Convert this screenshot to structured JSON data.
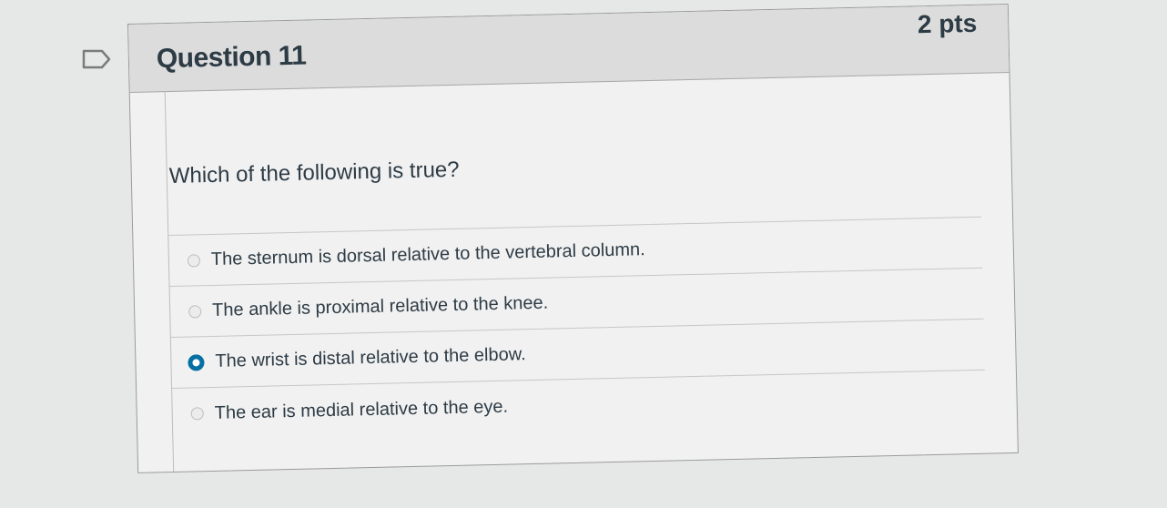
{
  "question": {
    "title": "Question 11",
    "points": "2 pts",
    "text": "Which of the following is true?",
    "answers": [
      {
        "label": "The sternum is dorsal relative to the vertebral column.",
        "selected": false
      },
      {
        "label": "The ankle is proximal relative to the knee.",
        "selected": false
      },
      {
        "label": "The wrist is distal relative to the elbow.",
        "selected": true
      },
      {
        "label": "The ear is medial relative to the eye.",
        "selected": false
      }
    ]
  },
  "colors": {
    "accent": "#0770a3",
    "text": "#2d3b45",
    "header_bg": "#dcdcdc",
    "card_bg": "#f1f1f1"
  },
  "icons": {
    "flag": "flag-question-icon"
  }
}
